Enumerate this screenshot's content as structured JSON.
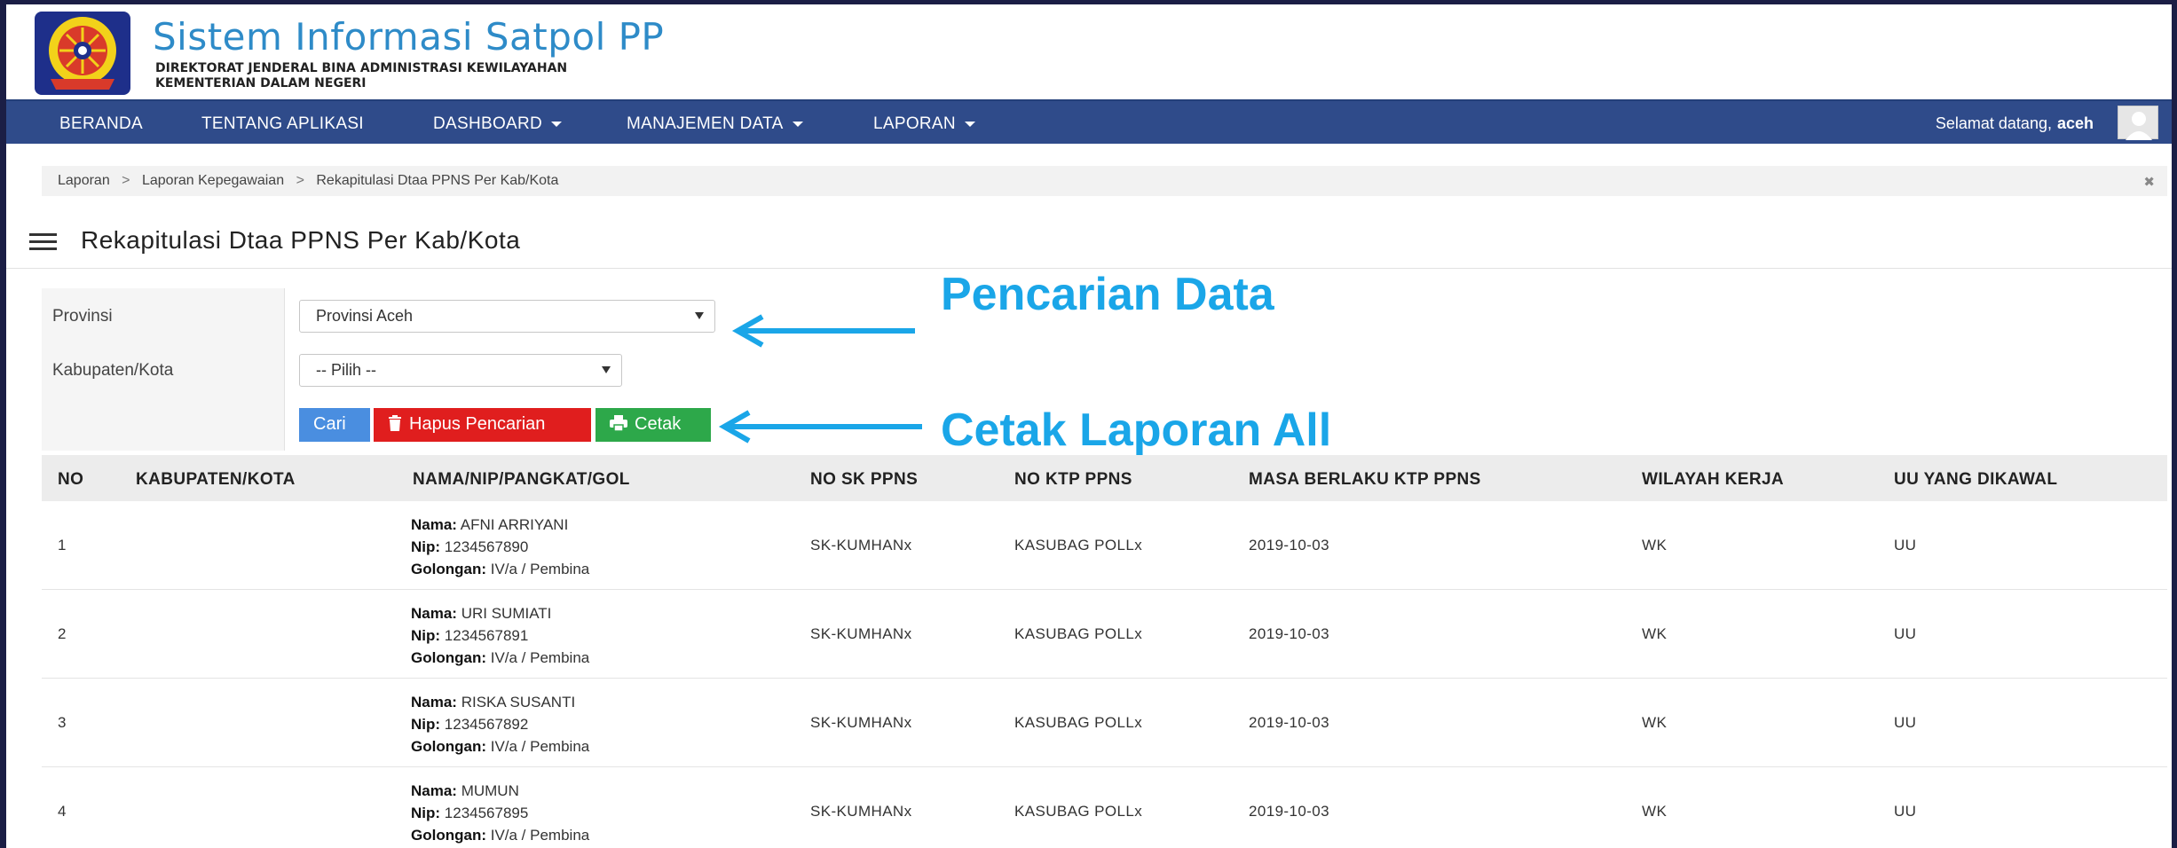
{
  "header": {
    "title": "Sistem Informasi Satpol PP",
    "subtitle_1": "DIREKTORAT JENDERAL BINA ADMINISTRASI KEWILAYAHAN",
    "subtitle_2": "KEMENTERIAN DALAM NEGERI"
  },
  "nav": {
    "items": [
      "BERANDA",
      "TENTANG APLIKASI",
      "DASHBOARD",
      "MANAJEMEN DATA",
      "LAPORAN"
    ],
    "welcome": "Selamat datang,",
    "username": "aceh"
  },
  "breadcrumb": [
    "Laporan",
    "Laporan Kepegawaian",
    "Rekapitulasi Dtaa PPNS Per Kab/Kota"
  ],
  "breadcrumb_sep": ">",
  "page_title": "Rekapitulasi Dtaa PPNS Per Kab/Kota",
  "form": {
    "provinsi_label": "Provinsi",
    "provinsi_value": "Provinsi Aceh",
    "kabupaten_label": "Kabupaten/Kota",
    "kabupaten_value": "-- Pilih --",
    "cari": "Cari",
    "hapus": "Hapus Pencarian",
    "cetak": "Cetak"
  },
  "annotations": {
    "search": "Pencarian Data",
    "print": "Cetak Laporan All",
    "color": "#1aa6e8"
  },
  "table": {
    "headers": [
      "NO",
      "KABUPATEN/KOTA",
      "NAMA/NIP/PANGKAT/GOL",
      "NO SK PPNS",
      "NO KTP PPNS",
      "MASA BERLAKU KTP PPNS",
      "WILAYAH KERJA",
      "UU YANG DIKAWAL"
    ],
    "field_labels": {
      "nama": "Nama:",
      "nip": "Nip:",
      "golongan": "Golongan:"
    },
    "rows": [
      {
        "no": "1",
        "kabupaten": "",
        "nama": "AFNI ARRIYANI",
        "nip": "1234567890",
        "golongan": "IV/a / Pembina",
        "sk": "SK-KUMHANx",
        "ktp": "KASUBAG POLLx",
        "masa": "2019-10-03",
        "wilayah": "WK",
        "uu": "UU"
      },
      {
        "no": "2",
        "kabupaten": "",
        "nama": "URI SUMIATI",
        "nip": "1234567891",
        "golongan": "IV/a / Pembina",
        "sk": "SK-KUMHANx",
        "ktp": "KASUBAG POLLx",
        "masa": "2019-10-03",
        "wilayah": "WK",
        "uu": "UU"
      },
      {
        "no": "3",
        "kabupaten": "",
        "nama": "RISKA SUSANTI",
        "nip": "1234567892",
        "golongan": "IV/a / Pembina",
        "sk": "SK-KUMHANx",
        "ktp": "KASUBAG POLLx",
        "masa": "2019-10-03",
        "wilayah": "WK",
        "uu": "UU"
      },
      {
        "no": "4",
        "kabupaten": "",
        "nama": "MUMUN",
        "nip": "1234567895",
        "golongan": "IV/a / Pembina",
        "sk": "SK-KUMHANx",
        "ktp": "KASUBAG POLLx",
        "masa": "2019-10-03",
        "wilayah": "WK",
        "uu": "UU"
      }
    ]
  },
  "colors": {
    "navbar": "#2f4b8a",
    "title": "#2e8bc8",
    "btn_cari": "#4a8ee0",
    "btn_hapus": "#e01e1e",
    "btn_cetak": "#2da84a"
  }
}
